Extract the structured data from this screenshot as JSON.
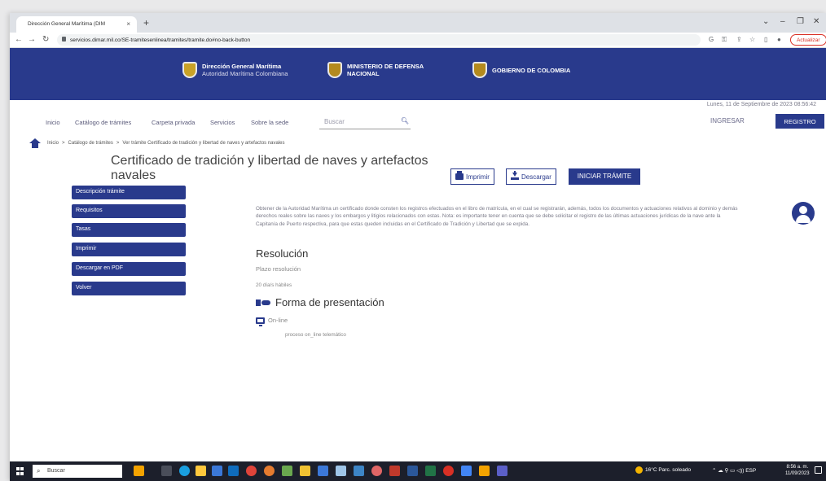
{
  "browser": {
    "tab_title": "Dirección General Marítima (DIM",
    "tab_close": "×",
    "new_tab": "+",
    "url": "servicios.dimar.mil.co/SE-tramitesenlinea/tramites/tramite.do#no-back-button",
    "actualizar": "Actualizar",
    "win_min": "–",
    "win_max": "❐",
    "win_close": "✕"
  },
  "header": {
    "dimar_title": "Dirección General Marítima",
    "dimar_subtitle": "Autoridad Marítima Colombiana",
    "ministerio": "MINISTERIO DE DEFENSA NACIONAL",
    "gobierno": "GOBIERNO DE COLOMBIA"
  },
  "date_text": "Lunes, 11 de Septiembre de 2023 08:56:42",
  "nav": {
    "items": [
      "Inicio",
      "Catálogo de trámites",
      "Carpeta privada",
      "Servicios",
      "Sobre la sede"
    ],
    "search_placeholder": "Buscar",
    "ingresar": "INGRESAR",
    "registro": "REGISTRO"
  },
  "breadcrumb": {
    "items": [
      "Inicio",
      "Catálogo de trámites",
      "Ver trámite Certificado de tradición y libertad de naves y artefactos navales"
    ],
    "separator": ">"
  },
  "page": {
    "title": "Certificado de tradición y libertad de naves y artefactos navales",
    "buttons": {
      "imprimir": "Imprimir",
      "descargar": "Descargar",
      "iniciar": "INICIAR TRÁMITE"
    }
  },
  "sidebar": {
    "items": [
      "Descripción trámite",
      "Requisitos",
      "Tasas",
      "Imprimir",
      "Descargar en PDF",
      "Volver"
    ]
  },
  "content": {
    "description": "Obtener de la Autoridad Marítima un certificado donde consten los registros efectuados en el libro de matrícula, en el cual se registrarán, además, todos los documentos y actuaciones relativos al dominio y demás derechos reales sobre las naves y los embargos y litigios relacionados con estas. Nota: es importante tener en cuenta que se debe solicitar el registro de las últimas actuaciones jurídicas de la nave ante la Capitanía de Puerto respectiva, para que estas queden incluidas en el Certificado de Tradición y Libertad que se expida.",
    "resolucion_heading": "Resolución",
    "plazo_label": "Plazo resolución",
    "plazo_value": "20 día/s hábiles",
    "forma_heading": "Forma de presentación",
    "online_label": "On-line",
    "online_detail": "proceso on_line telemático"
  },
  "taskbar": {
    "search_placeholder": "Buscar",
    "weather": "16°C  Parc. soleado",
    "lang": "ESP",
    "time": "8:56 a. m.",
    "date": "11/09/2023"
  },
  "colors": {
    "brand_blue": "#293a8c",
    "actualizar_red": "#d93025"
  }
}
